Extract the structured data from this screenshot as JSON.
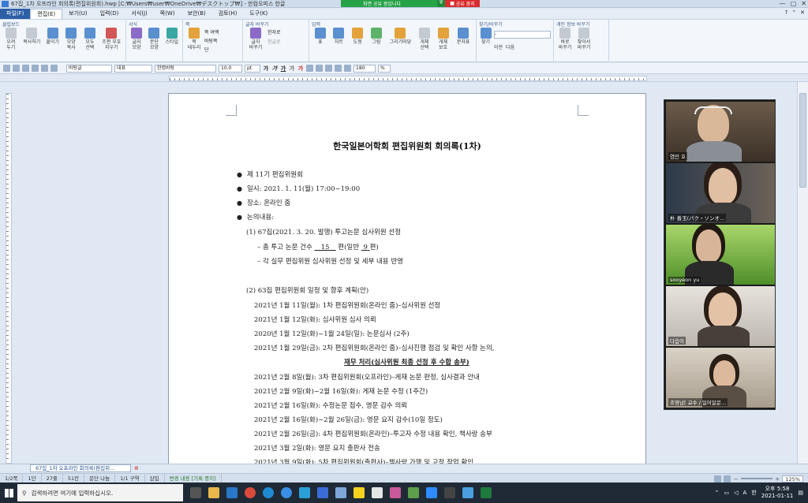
{
  "window": {
    "title": "67집_1차 오프라인 회의록(편집위원회).hwp [C:₩Users₩user₩OneDrive₩デスクトップ₩] - 한컴오피스 한글",
    "controls": [
      "—",
      "▢",
      "✕"
    ]
  },
  "share": {
    "message": "화면 공유 중입니다",
    "stop_label": "공유 중지"
  },
  "menu": {
    "items": [
      "파일(F)",
      "편집(E)",
      "보기(U)",
      "입력(D)",
      "서식(J)",
      "쪽(W)",
      "보안(B)",
      "검토(H)",
      "도구(K)"
    ],
    "right": [
      "?",
      "⌃",
      "✕"
    ]
  },
  "ribbon": {
    "groups": [
      {
        "title": "클립보드",
        "buttons": [
          "오려\n두기",
          "복사하기",
          "붙이기",
          "모양\n복사",
          "모두\n선택",
          "조판 부호\n지우기"
        ]
      },
      {
        "title": "서식",
        "buttons": [
          "글자\n모양",
          "문단\n모양",
          "스타일"
        ]
      },
      {
        "title": "쪽",
        "buttons": [
          "쪽\n테두리",
          "쪽 여백",
          "바탕쪽",
          "단"
        ]
      },
      {
        "title": "글자 바꾸기",
        "buttons": [
          "글자\n바꾸기",
          "한자로",
          "한글로"
        ]
      },
      {
        "title": "입력",
        "buttons": [
          "표",
          "차트",
          "도형",
          "그림",
          "그리기마당",
          "개체\n선택",
          "개체\n보호",
          "문자표"
        ]
      },
      {
        "title": "찾기/바꾸기",
        "buttons": [
          "찾기",
          "이전",
          "다음"
        ]
      },
      {
        "title": "개인 정보 바꾸기",
        "buttons": [
          "바로\n바꾸기",
          "찾아서\n바꾸기"
        ]
      }
    ]
  },
  "format": {
    "style": "바탕글",
    "lang": "대표",
    "font": "한컴바탕",
    "size": "10.0",
    "unit": "pt",
    "glyphs": [
      "가",
      "가",
      "가",
      "가",
      "가"
    ],
    "zoom": "180",
    "pct": "%"
  },
  "document": {
    "title": "한국일본어학회 편집위원회 회의록(1차)",
    "bullets": [
      "제 11기 편집위원회",
      "일시: 2021. 1. 11(월) 17:00~19:00",
      "장소: 온라인 줌",
      "논의내용:"
    ],
    "section1": {
      "heading": "(1) 67집(2021. 3. 20. 발행) 투고논문 심사위원 선정",
      "line_a_prefix": "– 총 투고 논문 건수",
      "total": "15",
      "line_a_mid": "편(일반",
      "general": "9",
      "line_a_suffix": "편)",
      "line_b": "– 각 실무 편집위원 심사위원 선정 및 세부 내용 반영"
    },
    "section2": {
      "heading": "(2) 63집 편집위원회 일정 및 향후 계획(안)",
      "items": [
        "2021년 1월 11일(월): 1차 편집위원회(온라인 줌)–심사위원 선정",
        "2021년 1월 12일(화): 심사위원 심사 의뢰",
        "2020년 1월 12일(화)~1월 24일(일): 논문심사 (2주)",
        "2021년 1월 29일(금): 2차 편집위원회(온라인 줌)–심사진행 점검 및 확인 사항 논의,"
      ],
      "subheading": "재무 처리(심사위원 최종 선정 후 수합 송부)",
      "items2": [
        "2021년 2월 8일(월): 3차 편집위원회(오프라인)–게재 논문 판정, 심사결과 안내",
        "2021년 2월 9일(화)~2월 16일(화): 게재 논문 수정 (1주간)",
        "2021년 2월 16일(화): 수정논문 접수, 영문 감수 의뢰",
        "2021년 2월 16일(화)~2월 26일(금): 영문 요지 감수(10일 정도)",
        "2021년 2월 26일(금): 4차 편집위원회(온라인)–투고자 수정 내용 확인, 책사랑 송부",
        "2021년 3월 2일(화): 영문 요지 출판사 전송",
        "2021년 3월 9일(화): 5차 편집위원회(출판사)–책사랑 가행 및 교정 작업 확인"
      ]
    }
  },
  "participants": [
    {
      "name": "염민 호"
    },
    {
      "name": "朴 善玉(パク・ソンオ…"
    },
    {
      "name": "sooyeon yu"
    },
    {
      "name": "다음이"
    },
    {
      "name": "조영남[ 교수 / 일어일문…"
    }
  ],
  "doc_tab": {
    "label": "67집_1차 오프라인 회의록(편집위...",
    "add": "⊕"
  },
  "status": {
    "items": [
      "1/2쪽",
      "1단",
      "27줄",
      "51칸",
      "문단 나눔",
      "1/1 구역",
      "삽입"
    ],
    "track": "변경 내용 [기록 중지]",
    "zoom": "125%"
  },
  "taskbar": {
    "search_placeholder": "검색하려면 여기에 입력하십시오.",
    "tray_lang": "A",
    "tray_ime": "한",
    "time": "오후 5:58",
    "date": "2021-01-11"
  },
  "colors": {
    "share_green": "#27a347",
    "stop_red": "#d92d2d",
    "file_menu": "#2d5fa6",
    "taskbar": "#1f2a36"
  }
}
